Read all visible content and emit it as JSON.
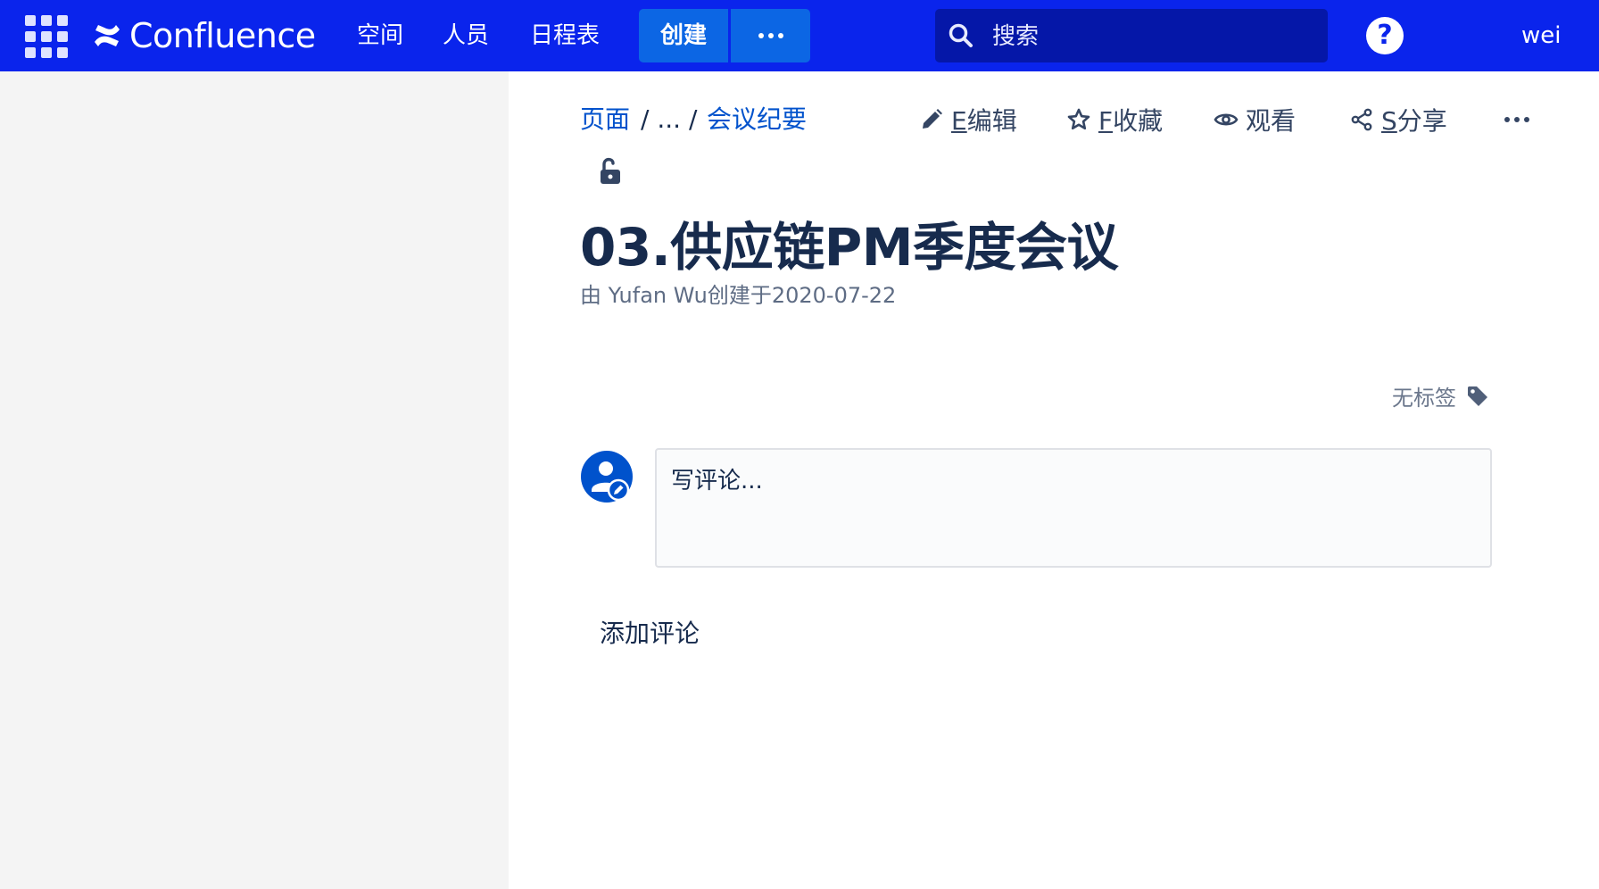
{
  "topbar": {
    "logo_text": "Confluence",
    "nav": [
      "空间",
      "人员",
      "日程表"
    ],
    "create_label": "创建",
    "search_placeholder": "搜索",
    "help_label": "?",
    "user_name": "wei"
  },
  "breadcrumb": {
    "root": "页面",
    "ellipsis": "/ ...",
    "sep": "/",
    "parent": "会议纪要"
  },
  "actions": {
    "edit_key": "E",
    "edit_label": "编辑",
    "fav_key": "F",
    "fav_label": "收藏",
    "watch_label": "观看",
    "share_key": "S",
    "share_label": "分享"
  },
  "page": {
    "title": "03.供应链PM季度会议",
    "byline": "由 Yufan Wu创建于2020-07-22",
    "labels_text": "无标签"
  },
  "comments": {
    "placeholder": "写评论...",
    "add_label": "添加评论"
  },
  "colors": {
    "topbar": "#0a24ec",
    "create_button": "#0c66e4",
    "search_bg": "#0517a8",
    "link": "#0052cc",
    "sidebar": "#f4f4f4"
  }
}
